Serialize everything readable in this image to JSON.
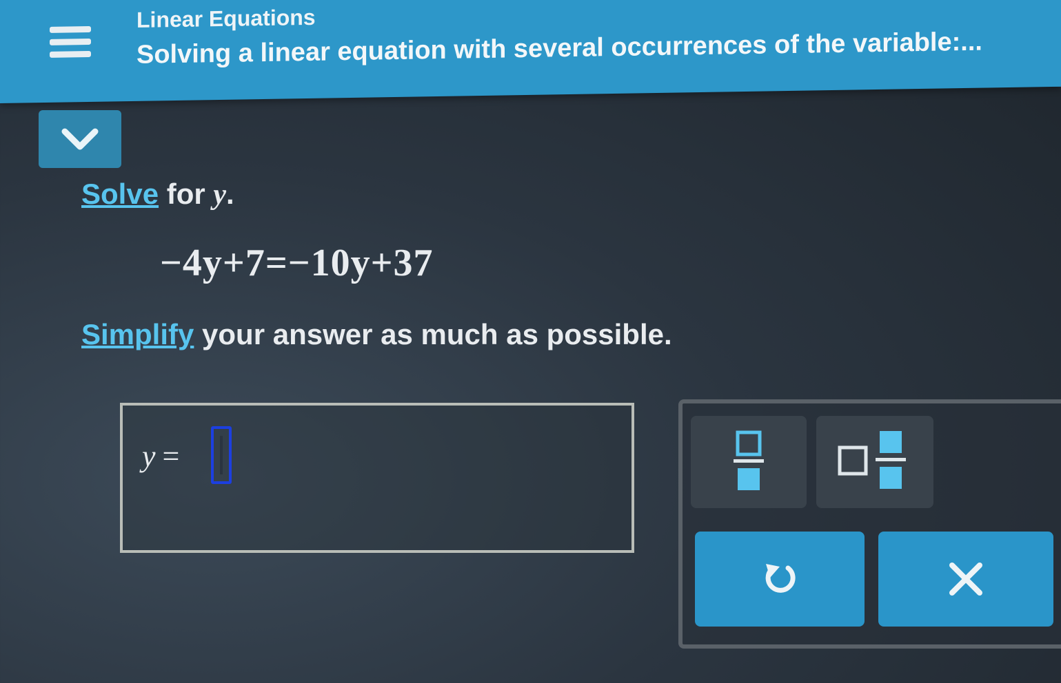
{
  "header": {
    "topic": "Linear Equations",
    "title": "Solving a linear equation with several occurrences of the variable:..."
  },
  "problem": {
    "prompt_link": "Solve",
    "prompt_rest": " for ",
    "prompt_var": "y",
    "prompt_end": ".",
    "equation": "−4y+7=−10y+37",
    "instruction_link": "Simplify",
    "instruction_rest": " your answer as much as possible."
  },
  "answer": {
    "label_var": "y",
    "label_eq": "="
  },
  "colors": {
    "header": "#2d97c9",
    "link": "#58c4ee",
    "button": "#2a95c9",
    "cursor": "#1c3fe0"
  },
  "icons": [
    "menu-icon",
    "chevron-down-icon",
    "fraction-icon",
    "mixed-number-icon",
    "undo-icon",
    "clear-icon"
  ]
}
